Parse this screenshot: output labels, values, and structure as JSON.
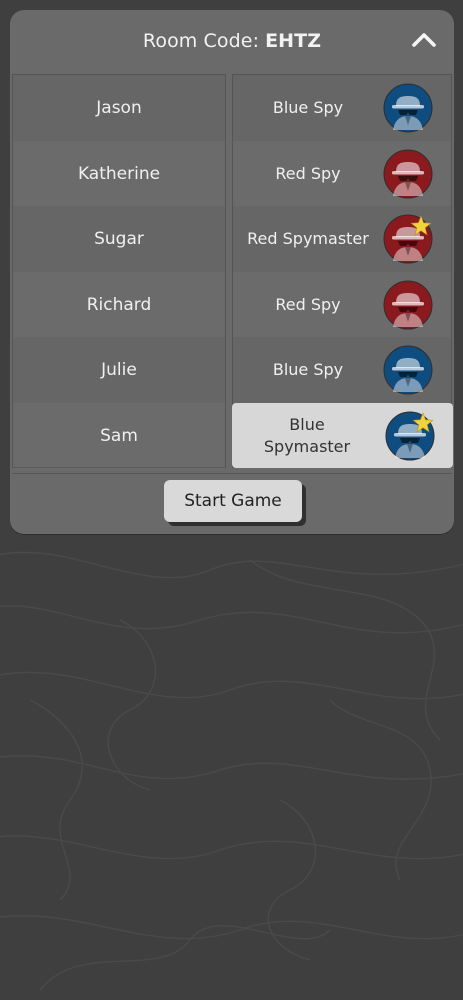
{
  "header": {
    "room_code_label": "Room Code:",
    "room_code": "EHTZ",
    "collapse_icon": "chevron-up-icon"
  },
  "players": [
    {
      "name": "Jason",
      "role": "Blue Spy",
      "team": "blue",
      "spymaster": false
    },
    {
      "name": "Katherine",
      "role": "Red Spy",
      "team": "red",
      "spymaster": false
    },
    {
      "name": "Sugar",
      "role": "Red Spymaster",
      "team": "red",
      "spymaster": true
    },
    {
      "name": "Richard",
      "role": "Red Spy",
      "team": "red",
      "spymaster": false
    },
    {
      "name": "Julie",
      "role": "Blue Spy",
      "team": "blue",
      "spymaster": false
    },
    {
      "name": "Sam",
      "role": "Blue Spymaster",
      "team": "blue",
      "spymaster": true,
      "selected": true
    }
  ],
  "start_button_label": "Start Game",
  "colors": {
    "blue_team": "#0f4c7f",
    "red_team": "#8b1a1f",
    "star": "#f4d23a"
  }
}
